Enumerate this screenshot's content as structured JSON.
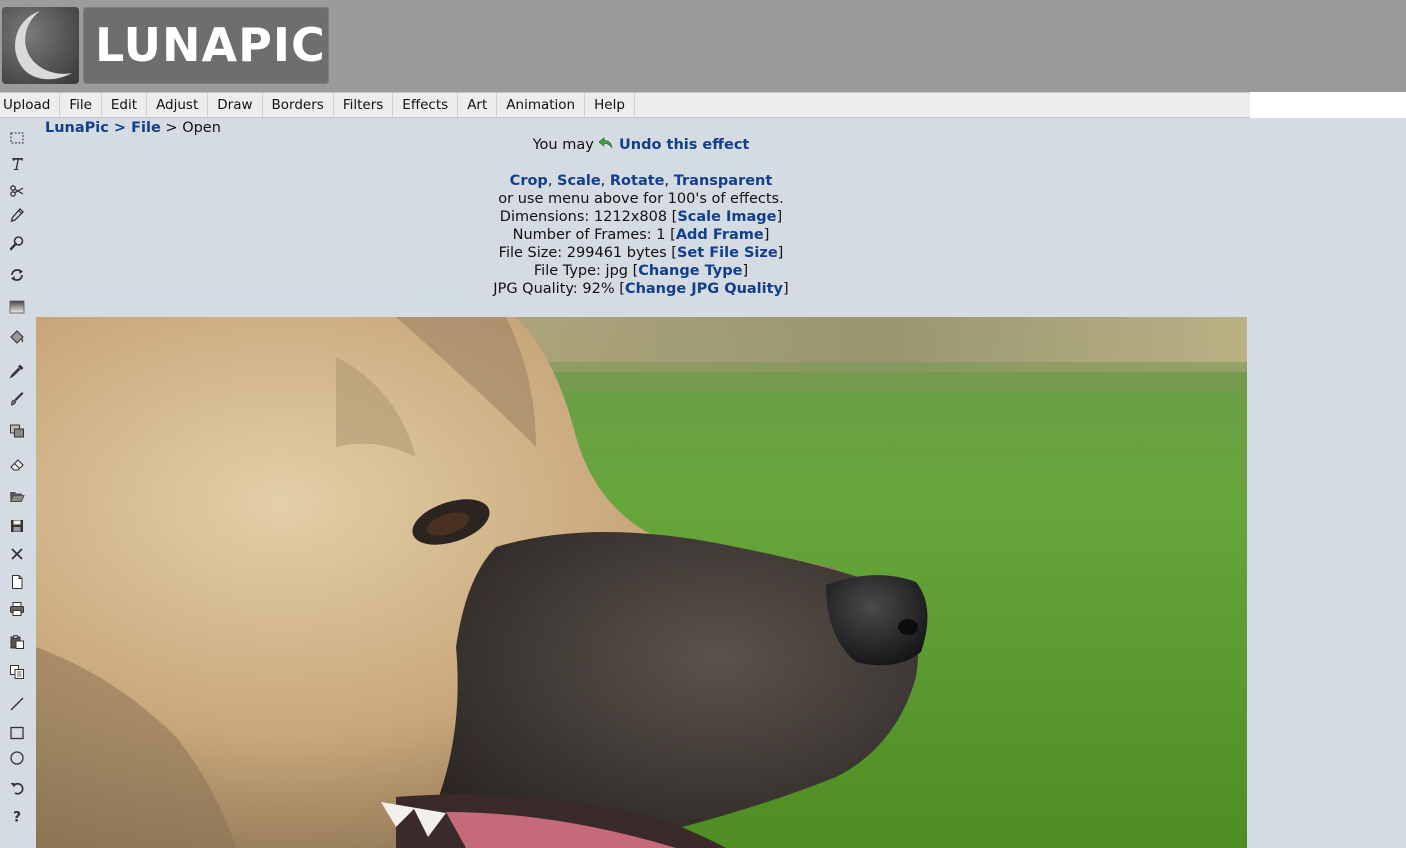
{
  "app": {
    "logo_text": "LUNAPIC"
  },
  "menu": {
    "items": [
      "Upload",
      "File",
      "Edit",
      "Adjust",
      "Draw",
      "Borders",
      "Filters",
      "Effects",
      "Art",
      "Animation",
      "Help"
    ]
  },
  "toolbar": {
    "tools": [
      "marquee-select-icon",
      "text-tool-icon",
      "scissors-icon",
      "pencil-icon",
      "zoom-icon",
      "rotate-icon",
      "gradient-icon",
      "paint-bucket-icon",
      "eyedropper-icon",
      "brush-icon",
      "clone-icon",
      "eraser-icon",
      "open-folder-icon",
      "save-icon",
      "close-icon",
      "new-document-icon",
      "print-icon",
      "paste-icon",
      "copy-icon",
      "line-icon",
      "rectangle-icon",
      "circle-icon",
      "undo-icon",
      "help-icon"
    ]
  },
  "breadcrumb": {
    "home": "LunaPic",
    "sep1": " > ",
    "section": "File",
    "sep2": " > ",
    "current": "Open"
  },
  "info": {
    "undo_prefix": "You may ",
    "undo_link": "Undo this effect",
    "quick_links": [
      "Crop",
      "Scale",
      "Rotate",
      "Transparent"
    ],
    "menu_hint": "or use menu above for 100's of effects.",
    "dimensions_label": "Dimensions: 1212x808",
    "dimensions_link": "Scale Image",
    "frames_label": "Number of Frames: 1",
    "frames_link": "Add Frame",
    "filesize_label": "File Size: 299461 bytes",
    "filesize_link": "Set File Size",
    "filetype_label": "File Type: jpg",
    "filetype_link": "Change Type",
    "quality_label": "JPG Quality: 92%",
    "quality_link": "Change JPG Quality"
  },
  "colors": {
    "header_bg": "#9b9b9b",
    "page_bg": "#d5dbe3",
    "link": "#123f8b",
    "menubar_bg": "#ededed"
  }
}
